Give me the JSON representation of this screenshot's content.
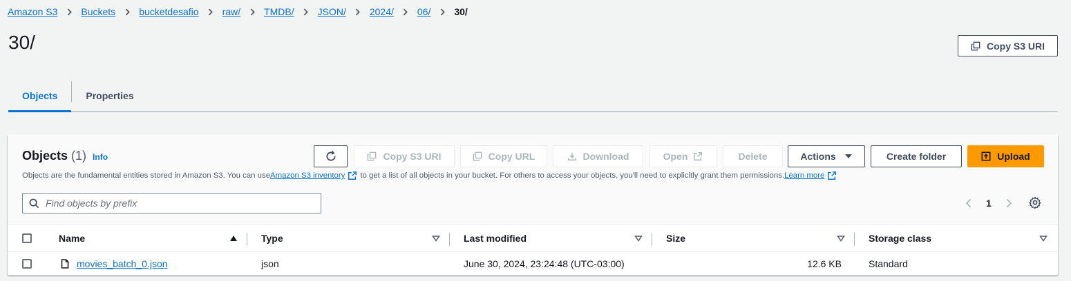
{
  "breadcrumb": {
    "items": [
      "Amazon S3",
      "Buckets",
      "bucketdesafio",
      "raw/",
      "TMDB/",
      "JSON/",
      "2024/",
      "06/"
    ],
    "current": "30/"
  },
  "header": {
    "title": "30/",
    "copy_s3_uri_label": "Copy S3 URI"
  },
  "tabs": [
    {
      "label": "Objects",
      "active": true
    },
    {
      "label": "Properties",
      "active": false
    }
  ],
  "objects_panel": {
    "title": "Objects",
    "count": "(1)",
    "info_label": "Info",
    "description": {
      "part1": "Objects are the fundamental entities stored in Amazon S3. You can use ",
      "link1": "Amazon S3 inventory",
      "part2": " to get a list of all objects in your bucket. For others to access your objects, you'll need to explicitly grant them permissions. ",
      "link2": "Learn more"
    },
    "toolbar": {
      "refresh_icon": "refresh-icon",
      "copy_s3_uri": "Copy S3 URI",
      "copy_url": "Copy URL",
      "download": "Download",
      "open": "Open",
      "delete": "Delete",
      "actions": "Actions",
      "create_folder": "Create folder",
      "upload": "Upload"
    },
    "search": {
      "placeholder": "Find objects by prefix",
      "value": ""
    },
    "pagination": {
      "current_page": "1"
    }
  },
  "table": {
    "columns": [
      "Name",
      "Type",
      "Last modified",
      "Size",
      "Storage class"
    ],
    "rows": [
      {
        "name": "movies_batch_0.json",
        "type": "json",
        "last_modified": "June 30, 2024, 23:24:48 (UTC-03:00)",
        "size": "12.6 KB",
        "storage_class": "Standard"
      }
    ]
  },
  "colors": {
    "link": "#0972d3",
    "primary_button": "#ff9900",
    "background": "#f2f3f3",
    "text": "#16191f"
  }
}
